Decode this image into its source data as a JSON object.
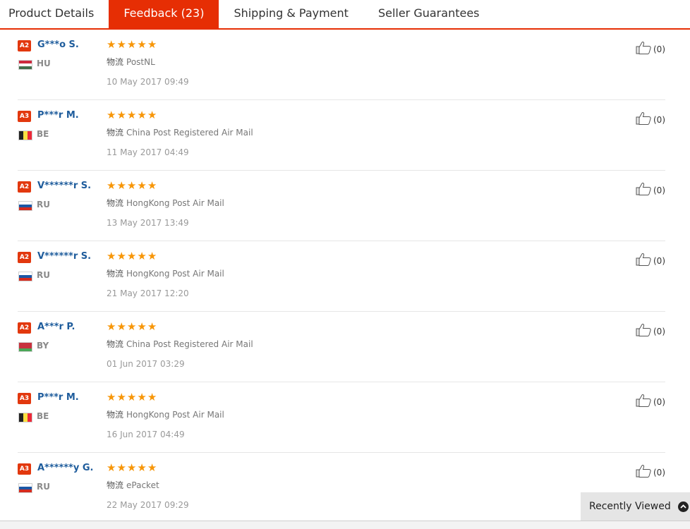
{
  "tabs": [
    {
      "label": "Product Details",
      "active": false
    },
    {
      "label": "Feedback (23)",
      "active": true
    },
    {
      "label": "Shipping & Payment",
      "active": false
    },
    {
      "label": "Seller Guarantees",
      "active": false
    }
  ],
  "shipping_label": "物流",
  "colors": {
    "accent": "#e62e04",
    "star": "#f79608",
    "username": "#1e5c9c"
  },
  "reviews": [
    {
      "level": "A2",
      "name": "G***o S.",
      "country": "HU",
      "rating": 5,
      "shipping": "PostNL",
      "date": "10 May 2017 09:49",
      "likes": "(0)"
    },
    {
      "level": "A3",
      "name": "P***r M.",
      "country": "BE",
      "rating": 5,
      "shipping": "China Post Registered Air Mail",
      "date": "11 May 2017 04:49",
      "likes": "(0)"
    },
    {
      "level": "A2",
      "name": "V******r S.",
      "country": "RU",
      "rating": 5,
      "shipping": "HongKong Post Air Mail",
      "date": "13 May 2017 13:49",
      "likes": "(0)"
    },
    {
      "level": "A2",
      "name": "V******r S.",
      "country": "RU",
      "rating": 5,
      "shipping": "HongKong Post Air Mail",
      "date": "21 May 2017 12:20",
      "likes": "(0)"
    },
    {
      "level": "A2",
      "name": "A***r P.",
      "country": "BY",
      "rating": 5,
      "shipping": "China Post Registered Air Mail",
      "date": "01 Jun 2017 03:29",
      "likes": "(0)"
    },
    {
      "level": "A3",
      "name": "P***r M.",
      "country": "BE",
      "rating": 5,
      "shipping": "HongKong Post Air Mail",
      "date": "16 Jun 2017 04:49",
      "likes": "(0)"
    },
    {
      "level": "A3",
      "name": "A******y G.",
      "country": "RU",
      "rating": 5,
      "shipping": "ePacket",
      "date": "22 May 2017 09:29",
      "likes": "(0)"
    }
  ],
  "recently_viewed": {
    "label": "Recently Viewed",
    "icon": "chevron-up-icon"
  }
}
